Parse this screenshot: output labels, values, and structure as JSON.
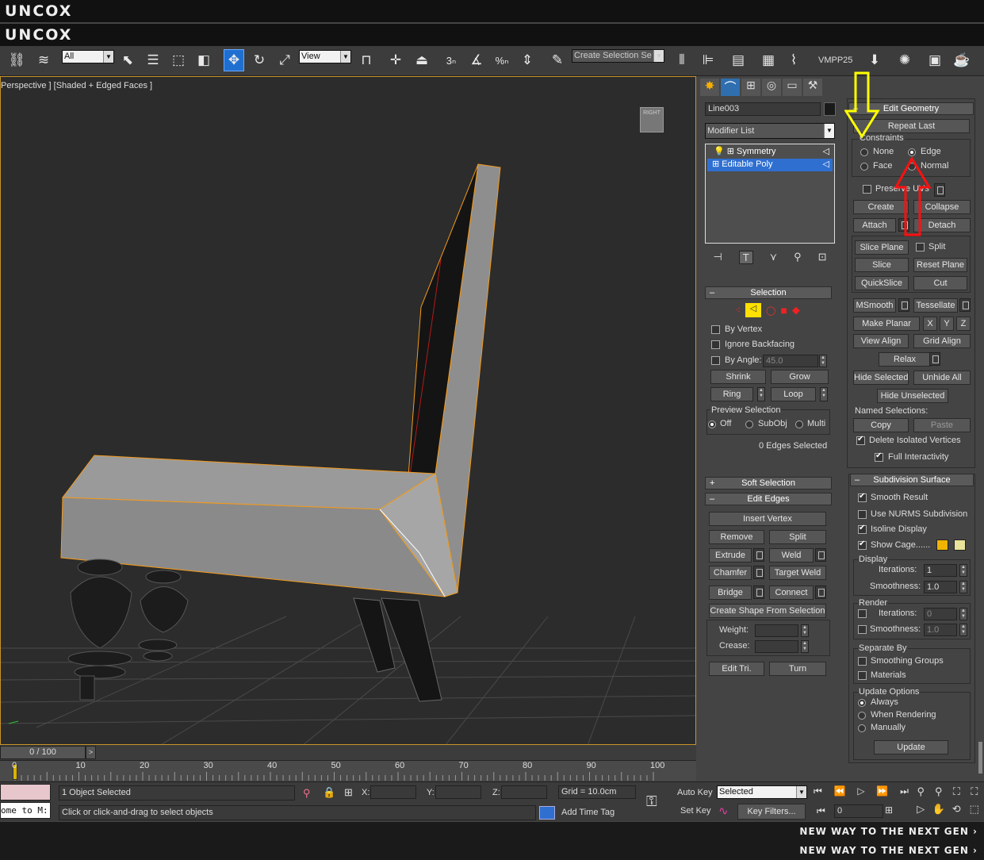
{
  "banner": {
    "top": "UNCOX",
    "bottom_text": "NEW WAY TO THE NEXT GEN ›"
  },
  "toolbar": {
    "filter": "All",
    "refcoord": "View",
    "selset": "Create Selection Se",
    "vmpp": "VMPP25",
    "snap_angle": "3",
    "snap_pct": "%"
  },
  "viewport": {
    "label": "Perspective ] [Shaded + Edged Faces ]",
    "viewcube": "RIGHT"
  },
  "modify": {
    "object_name": "Line003",
    "modifier_list": "Modifier List",
    "stack": [
      "Symmetry",
      "Editable Poly"
    ]
  },
  "selection": {
    "title": "Selection",
    "by_vertex": "By Vertex",
    "ignore_backfacing": "Ignore Backfacing",
    "by_angle": "By Angle:",
    "angle_value": "45.0",
    "shrink": "Shrink",
    "grow": "Grow",
    "ring": "Ring",
    "loop": "Loop",
    "preview_title": "Preview Selection",
    "off": "Off",
    "subobj": "SubObj",
    "multi": "Multi",
    "status": "0 Edges Selected"
  },
  "soft_selection": {
    "title": "Soft Selection",
    "sign": "+"
  },
  "edit_edges": {
    "title": "Edit Edges",
    "insert_vertex": "Insert Vertex",
    "remove": "Remove",
    "split": "Split",
    "extrude": "Extrude",
    "weld": "Weld",
    "chamfer": "Chamfer",
    "target_weld": "Target Weld",
    "bridge": "Bridge",
    "connect": "Connect",
    "create_shape": "Create Shape From Selection",
    "weight": "Weight:",
    "crease": "Crease:",
    "edit_tri": "Edit Tri.",
    "turn": "Turn"
  },
  "edit_geometry": {
    "title": "Edit Geometry",
    "repeat_last": "Repeat Last",
    "constraints": "Constraints",
    "none": "None",
    "edge": "Edge",
    "face": "Face",
    "normal": "Normal",
    "preserve_uvs": "Preserve UVs",
    "create": "Create",
    "collapse": "Collapse",
    "attach": "Attach",
    "detach": "Detach",
    "slice_plane": "Slice Plane",
    "split": "Split",
    "slice": "Slice",
    "reset_plane": "Reset Plane",
    "quickslice": "QuickSlice",
    "cut": "Cut",
    "msmooth": "MSmooth",
    "tessellate": "Tessellate",
    "make_planar": "Make Planar",
    "x": "X",
    "y": "Y",
    "z": "Z",
    "view_align": "View Align",
    "grid_align": "Grid Align",
    "relax": "Relax",
    "hide_selected": "Hide Selected",
    "unhide_all": "Unhide All",
    "hide_unselected": "Hide Unselected",
    "named_selections": "Named Selections:",
    "copy": "Copy",
    "paste": "Paste",
    "delete_isolated": "Delete Isolated Vertices",
    "full_interactivity": "Full Interactivity"
  },
  "subdivision": {
    "title": "Subdivision Surface",
    "smooth_result": "Smooth Result",
    "use_nurms": "Use NURMS Subdivision",
    "isoline": "Isoline Display",
    "show_cage": "Show Cage......",
    "display": "Display",
    "iterations": "Iterations:",
    "smoothness": "Smoothness:",
    "disp_iter": "1",
    "disp_smooth": "1.0",
    "render": "Render",
    "rend_iter": "0",
    "rend_smooth": "1.0",
    "separate_by": "Separate By",
    "smoothing_groups": "Smoothing Groups",
    "materials": "Materials",
    "update_options": "Update Options",
    "always": "Always",
    "when_rendering": "When Rendering",
    "manually": "Manually",
    "update": "Update"
  },
  "timeline": {
    "frame": "0 / 100",
    "ticks": [
      "0",
      "10",
      "20",
      "30",
      "40",
      "50",
      "60",
      "70",
      "80",
      "90",
      "100"
    ]
  },
  "status": {
    "objects": "1 Object Selected",
    "prompt": "Click or click-and-drag to select objects",
    "x": "X:",
    "y": "Y:",
    "z": "Z:",
    "grid": "Grid = 10.0cm",
    "auto_key": "Auto Key",
    "set_key": "Set Key",
    "selected": "Selected",
    "key_filters": "Key Filters...",
    "add_time_tag": "Add Time Tag",
    "frame_field": "0",
    "maxscript": "ome to M:"
  },
  "colors": {
    "accent": "#1f6fd0",
    "viewport_border": "#c8932a",
    "cage1": "#f0b400",
    "cage2": "#e8e29a"
  }
}
